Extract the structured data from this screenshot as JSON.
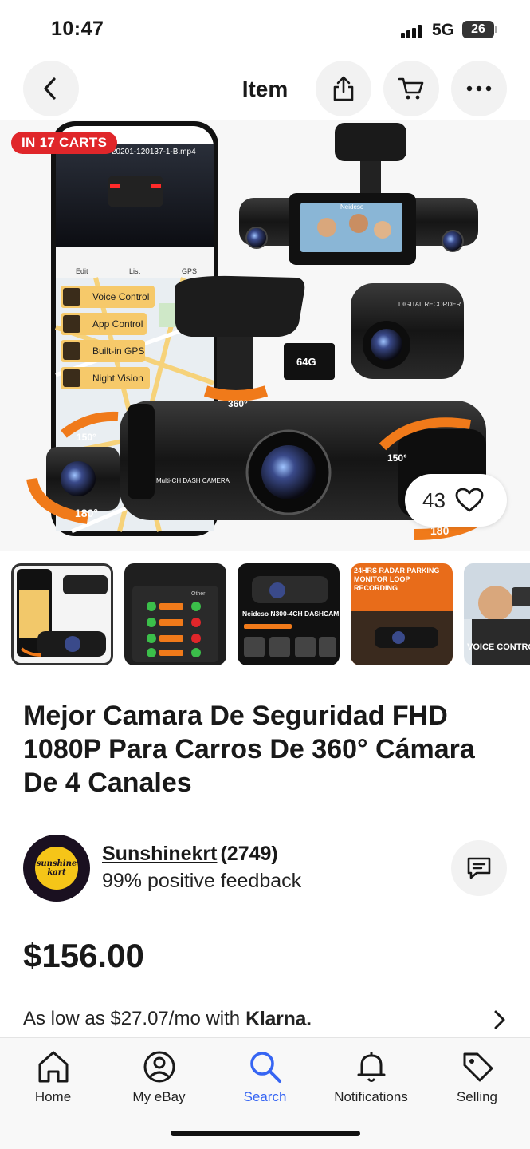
{
  "status_bar": {
    "time": "10:47",
    "network": "5G",
    "battery": "26"
  },
  "nav": {
    "title": "Item",
    "back_icon": "chevron-left-icon",
    "share_icon": "share-icon",
    "cart_icon": "cart-icon",
    "more_icon": "more-icon"
  },
  "hero": {
    "carts_badge": "IN 17 CARTS",
    "watch_count": "43",
    "heart_icon": "heart-icon",
    "image": {
      "filename": "20201-120137-1-B.mp4",
      "phone_tabs": [
        "Edit",
        "List",
        "GPS"
      ],
      "features": [
        "Voice Control",
        "App Control",
        "Built-in GPS",
        "Night Vision"
      ],
      "sd_card": "64G",
      "brand": "Neideso",
      "rear_cam_label": "DIGITAL RECORDER",
      "main_cam_label": "Multi-CH DASH CAMERA",
      "angles": [
        "360°",
        "150°",
        "150°",
        "180°",
        "180"
      ]
    }
  },
  "thumbnails": [
    {
      "label": ""
    },
    {
      "label": "Other"
    },
    {
      "label": "Neideso N300-4CH DASHCAM"
    },
    {
      "label": "24HRS RADAR PARKING MONITOR LOOP RECORDING"
    },
    {
      "label": "VOICE CONTROL"
    }
  ],
  "listing": {
    "title": "Mejor Camara De Seguridad FHD 1080P Para Carros De 360° Cámara De 4 Canales",
    "price": "$156.00"
  },
  "seller": {
    "logo_text": "sunshine kart",
    "name": "Sunshinekrt",
    "count": "(2749)",
    "feedback": "99% positive feedback",
    "message_icon": "message-icon"
  },
  "financing": {
    "text": "As low as $27.07/mo with",
    "brand": "Klarna."
  },
  "tabs": [
    {
      "label": "Home",
      "icon": "home-icon"
    },
    {
      "label": "My eBay",
      "icon": "user-icon"
    },
    {
      "label": "Search",
      "icon": "search-icon"
    },
    {
      "label": "Notifications",
      "icon": "bell-icon"
    },
    {
      "label": "Selling",
      "icon": "tag-icon"
    }
  ],
  "colors": {
    "accent": "#3665f3",
    "badge": "#e0262a",
    "text": "#191919",
    "orange": "#f07a1a"
  }
}
